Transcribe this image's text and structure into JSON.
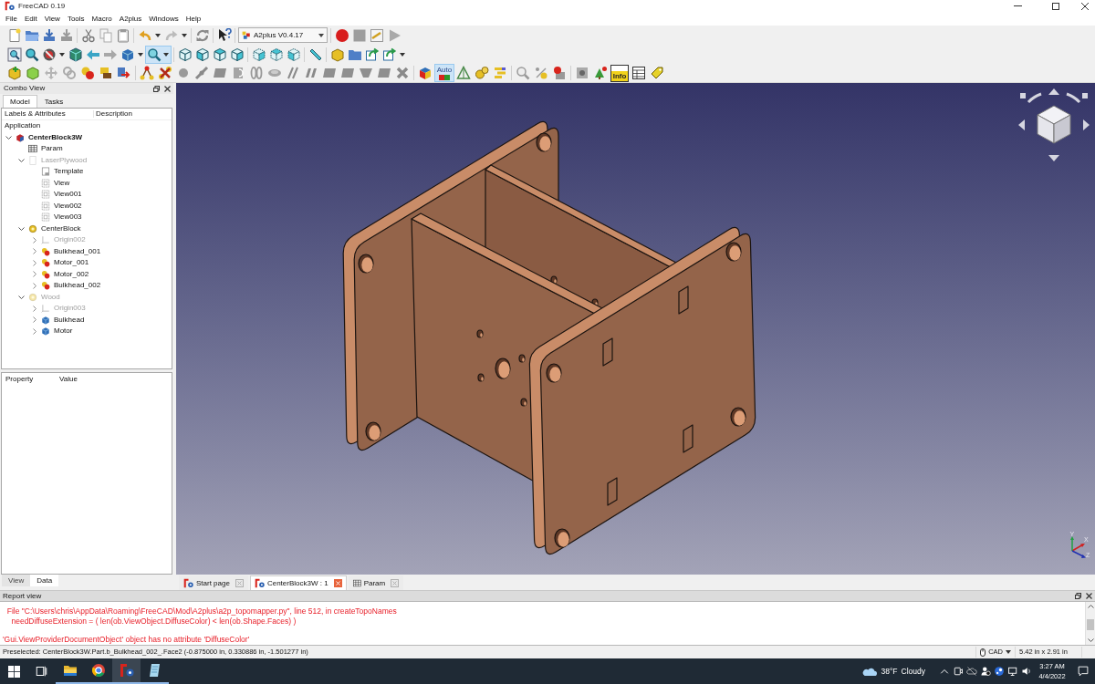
{
  "window": {
    "title": "FreeCAD 0.19"
  },
  "menu": [
    "File",
    "Edit",
    "View",
    "Tools",
    "Macro",
    "A2plus",
    "Windows",
    "Help"
  ],
  "toolbar": {
    "workbench": "A2plus V0.4.17",
    "zoom_tool_active": true,
    "auto_toggle": {
      "label": "Auto",
      "on": true
    },
    "info_label": "Info"
  },
  "combo_view": {
    "title": "Combo View",
    "tabs": [
      {
        "label": "Model",
        "selected": true
      },
      {
        "label": "Tasks",
        "selected": false
      }
    ],
    "tree": {
      "columns": [
        "Labels & Attributes",
        "Description"
      ],
      "root": "Application",
      "items": [
        {
          "label": "CenterBlock3W",
          "kind": "document",
          "active": true,
          "visible": true,
          "expanded": true,
          "children": [
            {
              "label": "Param",
              "kind": "spreadsheet",
              "visible": true
            },
            {
              "label": "LaserPlywood",
              "kind": "page",
              "visible": false,
              "expanded": true,
              "children": [
                {
                  "label": "Template",
                  "kind": "template",
                  "visible": true
                },
                {
                  "label": "View",
                  "kind": "view",
                  "visible": true
                },
                {
                  "label": "View001",
                  "kind": "view",
                  "visible": true
                },
                {
                  "label": "View002",
                  "kind": "view",
                  "visible": true
                },
                {
                  "label": "View003",
                  "kind": "view",
                  "visible": true
                }
              ]
            },
            {
              "label": "CenterBlock",
              "kind": "part",
              "visible": true,
              "expanded": true,
              "children": [
                {
                  "label": "Origin002",
                  "kind": "origin",
                  "visible": false,
                  "expanded": false
                },
                {
                  "label": "Bulkhead_001",
                  "kind": "assembly-part",
                  "visible": true,
                  "expanded": false
                },
                {
                  "label": "Motor_001",
                  "kind": "assembly-part",
                  "visible": true,
                  "expanded": false
                },
                {
                  "label": "Motor_002",
                  "kind": "assembly-part",
                  "visible": true,
                  "expanded": false
                },
                {
                  "label": "Bulkhead_002",
                  "kind": "assembly-part",
                  "visible": true,
                  "expanded": false
                }
              ]
            },
            {
              "label": "Wood",
              "kind": "part",
              "visible": false,
              "expanded": true,
              "children": [
                {
                  "label": "Origin003",
                  "kind": "origin",
                  "visible": false,
                  "expanded": false
                },
                {
                  "label": "Bulkhead",
                  "kind": "body",
                  "visible": true,
                  "expanded": false
                },
                {
                  "label": "Motor",
                  "kind": "body",
                  "visible": true,
                  "expanded": false
                }
              ]
            }
          ]
        }
      ]
    },
    "property_columns": [
      "Property",
      "Value"
    ],
    "bottom_tabs": [
      {
        "label": "View",
        "selected": false
      },
      {
        "label": "Data",
        "selected": true
      }
    ]
  },
  "document_tabs": [
    {
      "label": "Start page",
      "kind": "start",
      "selected": false
    },
    {
      "label": "CenterBlock3W : 1",
      "kind": "document",
      "selected": true
    },
    {
      "label": "Param",
      "kind": "spreadsheet",
      "selected": false
    }
  ],
  "viewer": {
    "axis_labels": [
      "X",
      "Y",
      "Z"
    ]
  },
  "report_view": {
    "title": "Report view",
    "entries": [
      {
        "kind": "error",
        "lines": [
          "  File \"C:\\Users\\chris\\AppData\\Roaming\\FreeCAD\\Mod\\A2plus\\a2p_topomapper.py\", line 512, in createTopoNames",
          "    needDiffuseExtension = ( len(ob.ViewObject.DiffuseColor) < len(ob.Shape.Faces) )"
        ]
      },
      {
        "kind": "error",
        "lines": [
          "'Gui.ViewProviderDocumentObject' object has no attribute 'DiffuseColor'"
        ]
      }
    ]
  },
  "status_bar": {
    "message": "Preselected: CenterBlock3W.Part.b_Bulkhead_002_.Face2 (-0.875000 in, 0.330886 in, -1.501277 in)",
    "navigation_style": "CAD",
    "dimensions": "5.42 in x 2.91 in"
  },
  "taskbar": {
    "apps": [
      {
        "kind": "folder",
        "running": true,
        "selected": false
      },
      {
        "kind": "browser",
        "running": true,
        "selected": false
      },
      {
        "kind": "freecad",
        "running": true,
        "selected": true
      },
      {
        "kind": "notes",
        "running": true,
        "selected": false
      }
    ],
    "weather": {
      "temperature": "38°F",
      "condition": "Cloudy"
    },
    "time": "3:27 AM",
    "date": "4/4/2022"
  }
}
